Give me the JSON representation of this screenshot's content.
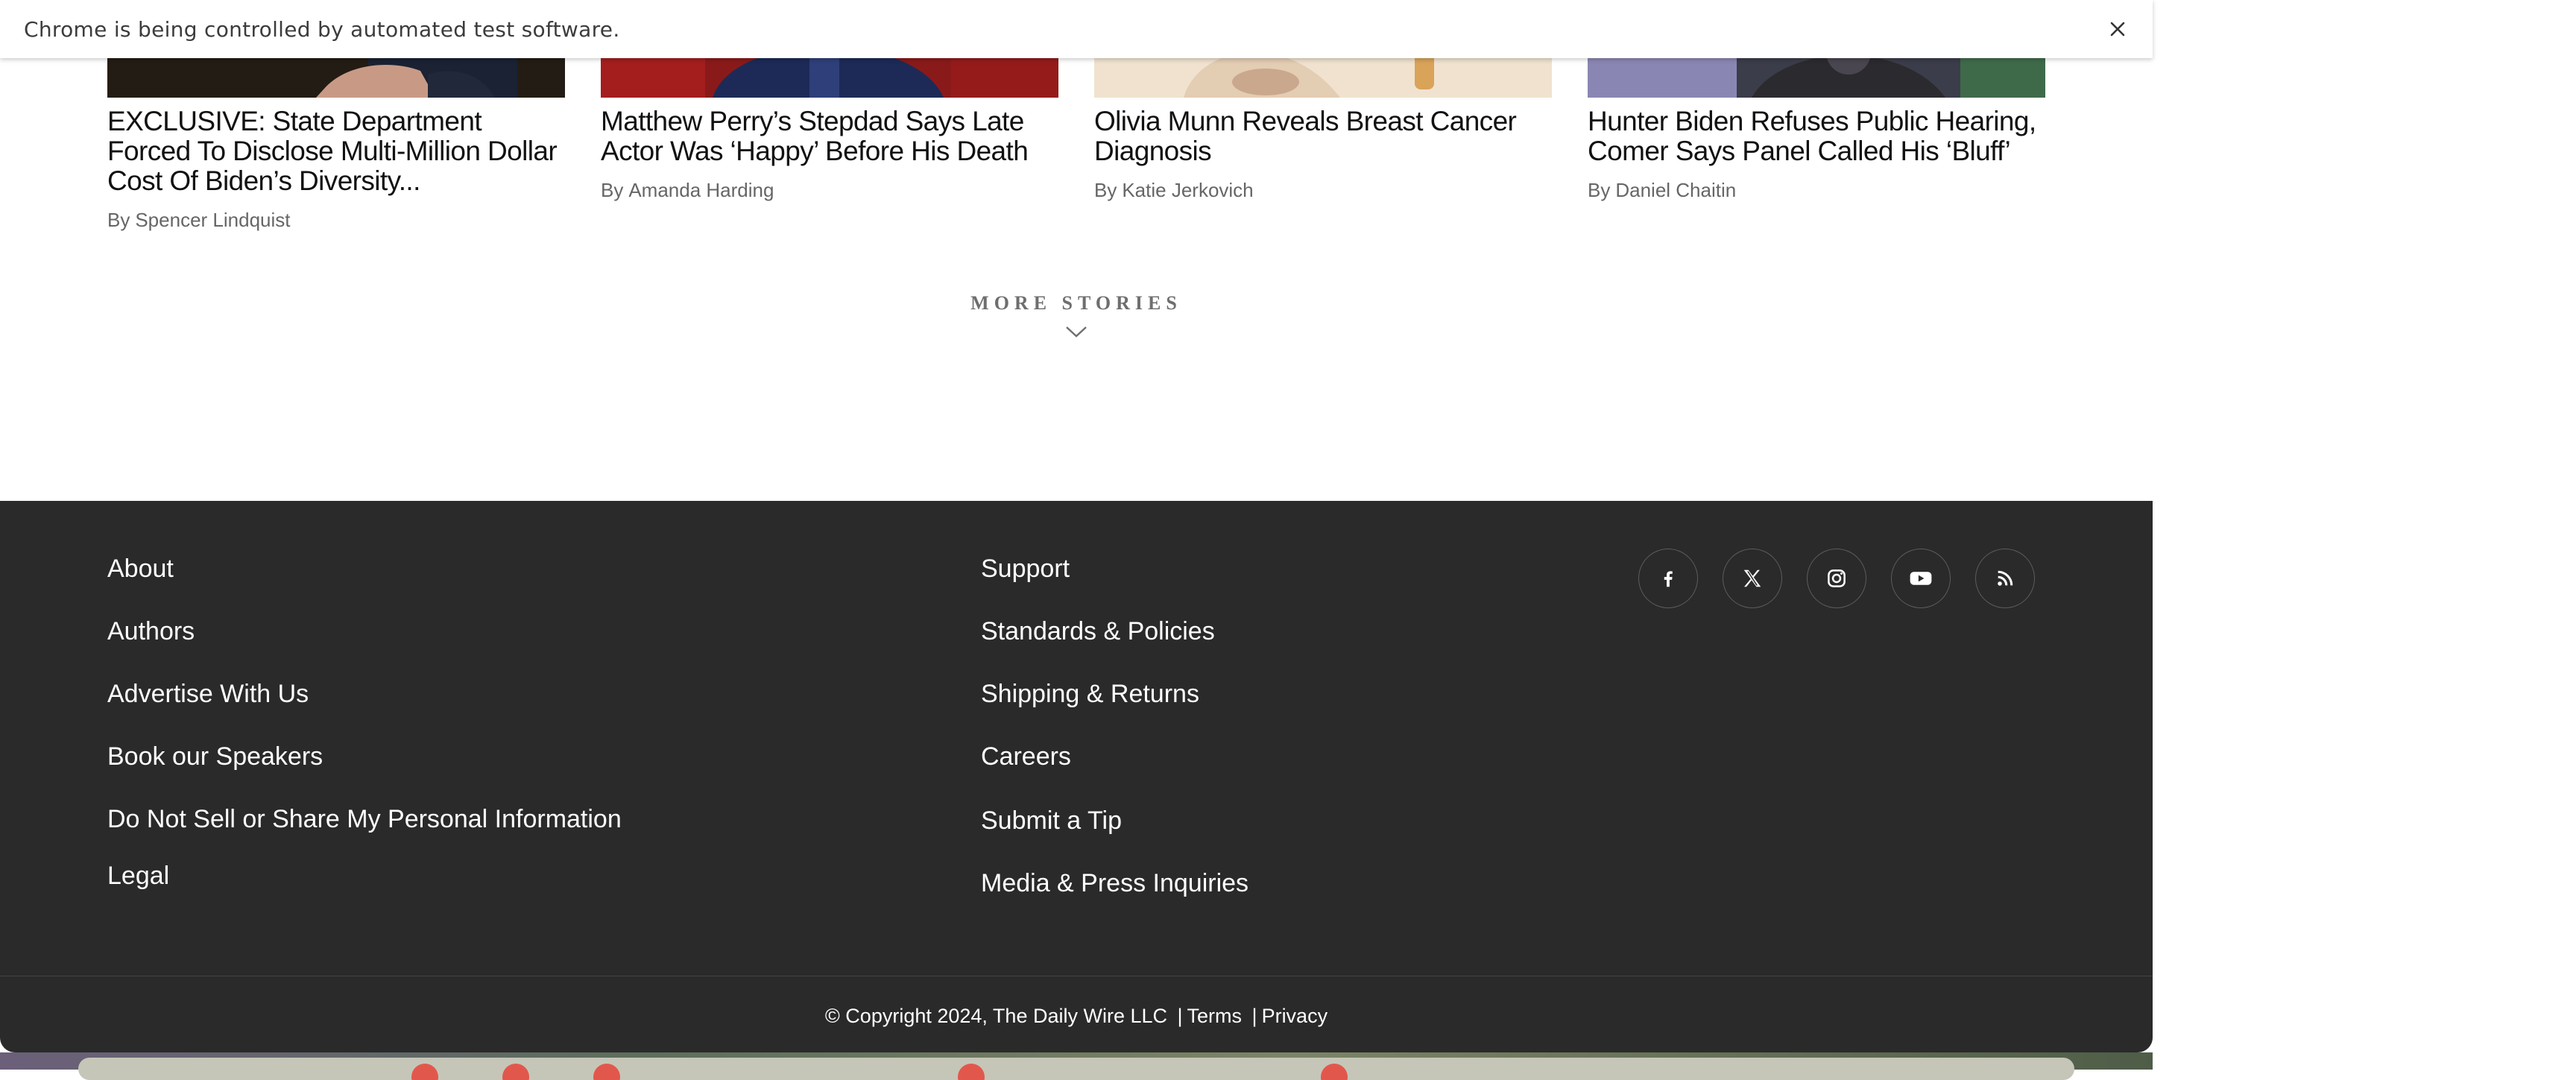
{
  "automation_bar": {
    "message": "Chrome is being controlled by automated test software.",
    "close_icon": "close-icon"
  },
  "articles": [
    {
      "title": "EXCLUSIVE: State Department Forced To Disclose Multi-Million Dollar Cost Of Biden’s Diversity...",
      "by": "By",
      "author": "Spencer Lindquist"
    },
    {
      "title": "Matthew Perry’s Stepdad Says Late Actor Was ‘Happy’ Before His Death",
      "by": "By",
      "author": "Amanda Harding"
    },
    {
      "title": "Olivia Munn Reveals Breast Cancer Diagnosis",
      "by": "By",
      "author": "Katie Jerkovich"
    },
    {
      "title": "Hunter Biden Refuses Public Hearing, Comer Says Panel Called His ‘Bluff’",
      "by": "By",
      "author": "Daniel Chaitin"
    }
  ],
  "more_stories": {
    "label": "MORE STORIES",
    "icon": "chevron-down-icon"
  },
  "footer": {
    "column1": [
      "About",
      "Authors",
      "Advertise With Us",
      "Book our Speakers",
      "Do Not Sell or Share My Personal Information",
      "Legal"
    ],
    "column2": [
      "Support",
      "Standards & Policies",
      "Shipping & Returns",
      "Careers",
      "Submit a Tip",
      "Media & Press Inquiries"
    ],
    "social_icons": [
      "facebook-icon",
      "x-icon",
      "instagram-icon",
      "youtube-icon",
      "rss-icon"
    ],
    "copyright": "© Copyright 2024, The Daily Wire LLC",
    "separator": "|",
    "terms": "Terms",
    "privacy": "Privacy"
  },
  "colors": {
    "footer_bg": "#2a2a2a",
    "footer_text": "#ffffff",
    "headline": "#111111",
    "byline": "#666666",
    "more_stories": "#6e6e6e"
  }
}
